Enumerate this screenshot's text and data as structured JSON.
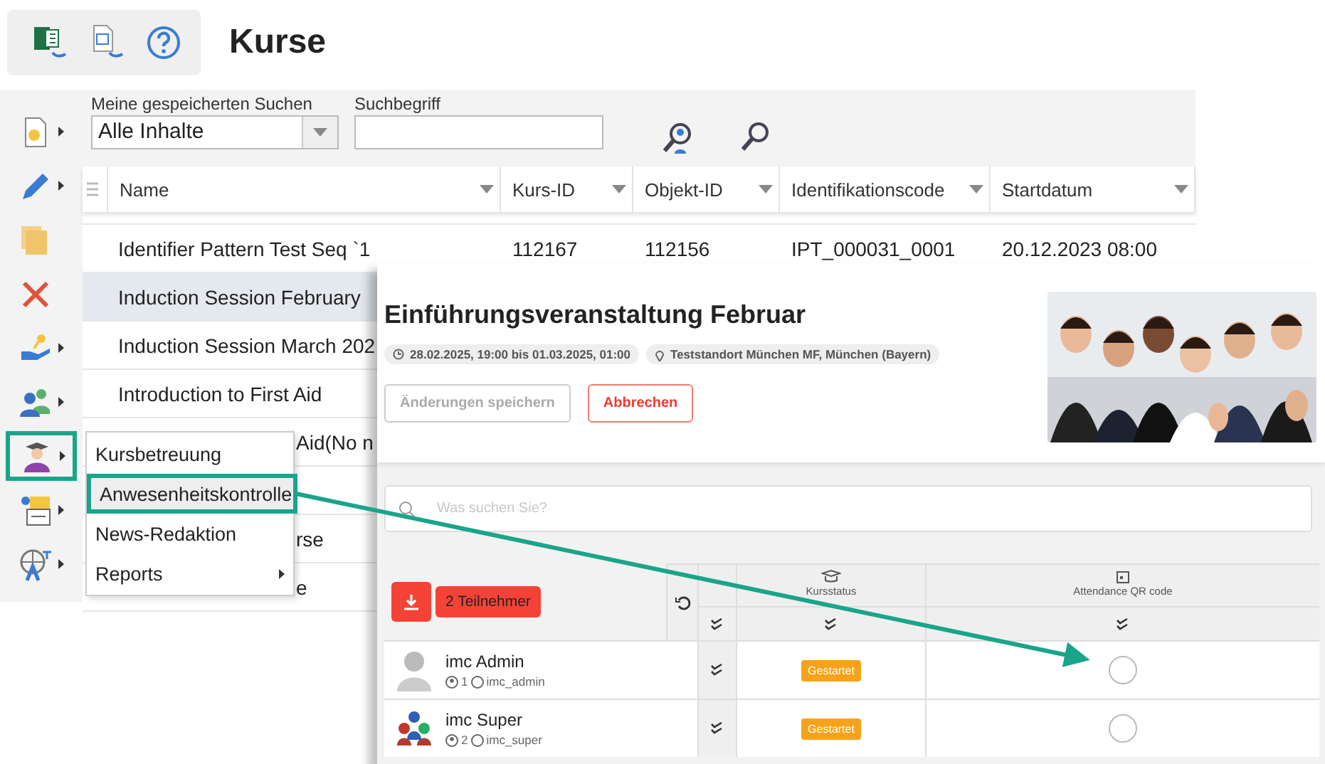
{
  "toolbar": {
    "title": "Kurse"
  },
  "filters": {
    "saved_search": {
      "label": "Meine gespeicherten Suchen",
      "value": "Alle Inhalte"
    },
    "search": {
      "label": "Suchbegriff"
    }
  },
  "sidebar": {
    "items": [
      {
        "kind": "document",
        "selected": false,
        "has_submenu": true
      },
      {
        "kind": "pencil",
        "selected": false,
        "has_submenu": true
      },
      {
        "kind": "copies",
        "selected": false,
        "has_submenu": false
      },
      {
        "kind": "delete",
        "selected": false,
        "has_submenu": false
      },
      {
        "kind": "hand",
        "selected": false,
        "has_submenu": true
      },
      {
        "kind": "users",
        "selected": false,
        "has_submenu": true
      },
      {
        "kind": "teacher",
        "selected": true,
        "has_submenu": true
      },
      {
        "kind": "folder",
        "selected": false,
        "has_submenu": true
      },
      {
        "kind": "globe",
        "selected": false,
        "has_submenu": true
      }
    ]
  },
  "table": {
    "columns": [
      "Name",
      "Kurs-ID",
      "Objekt-ID",
      "Identifikationscode",
      "Startdatum"
    ],
    "rows": [
      {
        "name": "Identifier Pattern Test Seq `1",
        "cells": [
          "112167",
          "112156",
          "IPT_000031_0001",
          "20.12.2023 08:00"
        ],
        "selected": false
      },
      {
        "name": "Induction Session February",
        "selected": true
      },
      {
        "name": "Induction Session March 202",
        "selected": false
      },
      {
        "name": "Introduction to First Aid",
        "selected": false
      },
      {
        "name": "Aid(No n",
        "kind": "partial",
        "selected": false
      },
      {
        "kind": "covered",
        "selected": false
      },
      {
        "name": "rse",
        "kind": "partial",
        "selected": false
      },
      {
        "name": "e",
        "kind": "partial",
        "selected": false
      }
    ]
  },
  "context_menu": {
    "items": [
      {
        "label": "Kursbetreuung",
        "selected": false,
        "has_submenu": false
      },
      {
        "label": "Anwesenheitskontrolle",
        "selected": true,
        "has_submenu": false
      },
      {
        "label": "News-Redaktion",
        "selected": false,
        "has_submenu": false
      },
      {
        "label": "Reports",
        "selected": false,
        "has_submenu": true
      }
    ]
  },
  "modal": {
    "title": "Einführungsveranstaltung Februar",
    "date": "28.02.2025, 19:00 bis 01.03.2025, 01:00",
    "location": "Teststandort München MF, München (Bayern)",
    "save_button": {
      "label": "Änderungen speichern",
      "disabled": true
    },
    "cancel_button": {
      "label": "Abbrechen"
    },
    "search": {
      "placeholder": "Was suchen Sie?"
    },
    "participants_button": "2 Teilnehmer",
    "columns": [
      "Kursstatus",
      "Attendance QR code"
    ],
    "participants": [
      {
        "name": "imc Admin",
        "number": "1",
        "login": "imc_admin",
        "status": "Gestartet",
        "kind": "grey",
        "attended": false
      },
      {
        "name": "imc Super",
        "number": "2",
        "login": "imc_super",
        "status": "Gestartet",
        "kind": "color",
        "attended": false
      }
    ]
  }
}
